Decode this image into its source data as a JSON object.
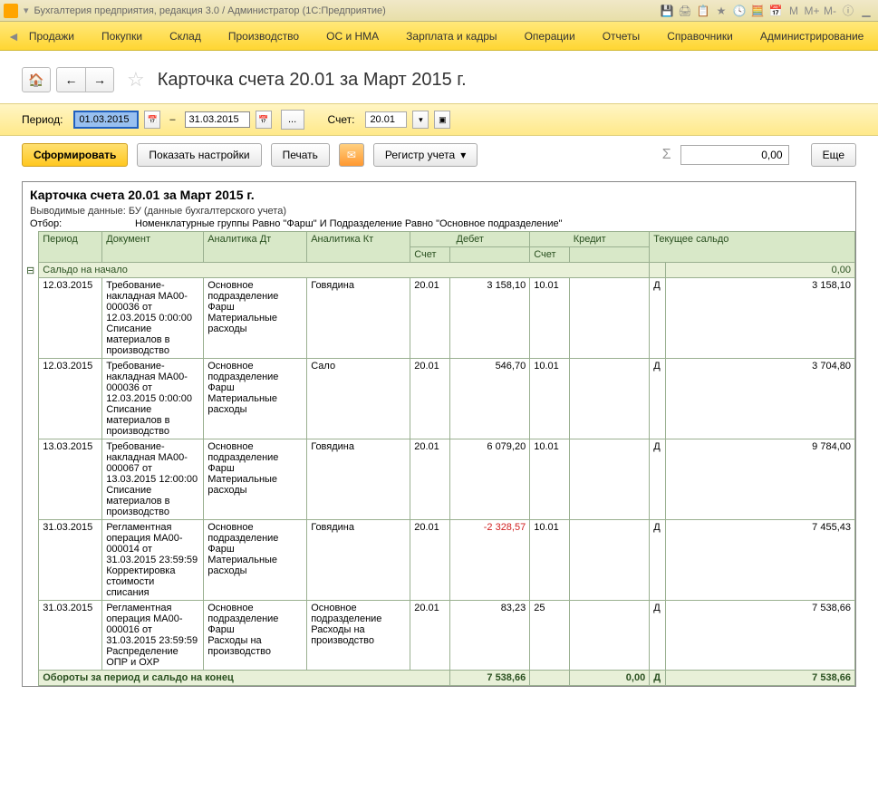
{
  "titlebar": {
    "title": "Бухгалтерия предприятия, редакция 3.0 / Администратор  (1С:Предприятие)"
  },
  "menu": [
    "Продажи",
    "Покупки",
    "Склад",
    "Производство",
    "ОС и НМА",
    "Зарплата и кадры",
    "Операции",
    "Отчеты",
    "Справочники",
    "Администрирование"
  ],
  "page": {
    "title": "Карточка счета 20.01 за Март 2015 г."
  },
  "period": {
    "label": "Период:",
    "from": "01.03.2015",
    "to": "31.03.2015",
    "acct_label": "Счет:",
    "acct": "20.01"
  },
  "actions": {
    "generate": "Сформировать",
    "show_settings": "Показать настройки",
    "print": "Печать",
    "register": "Регистр учета",
    "sum": "0,00",
    "more": "Еще"
  },
  "report": {
    "title": "Карточка счета 20.01 за Март 2015 г.",
    "data_label": "Выводимые данные:",
    "data_value": "БУ (данные бухгалтерского учета)",
    "filter_label": "Отбор:",
    "filter_value": "Номенклатурные группы Равно \"Фарш\" И Подразделение Равно \"Основное подразделение\"",
    "cols": {
      "period": "Период",
      "doc": "Документ",
      "adt": "Аналитика Дт",
      "akt": "Аналитика Кт",
      "debit": "Дебет",
      "credit": "Кредит",
      "acct": "Счет",
      "balance": "Текущее сальдо"
    },
    "saldo_start": "Сальдо на начало",
    "saldo_start_val": "0,00",
    "rows": [
      {
        "period": "12.03.2015",
        "doc": "Требование-накладная МА00-000036 от 12.03.2015 0:00:00\nСписание материалов в производство",
        "adt": "Основное подразделение\nФарш\nМатериальные расходы",
        "akt": "Говядина",
        "d_acct": "20.01",
        "d_amt": "3 158,10",
        "c_acct": "10.01",
        "c_amt": "",
        "side": "Д",
        "bal": "3 158,10"
      },
      {
        "period": "12.03.2015",
        "doc": "Требование-накладная МА00-000036 от 12.03.2015 0:00:00\nСписание материалов в производство",
        "adt": "Основное подразделение\nФарш\nМатериальные расходы",
        "akt": "Сало",
        "d_acct": "20.01",
        "d_amt": "546,70",
        "c_acct": "10.01",
        "c_amt": "",
        "side": "Д",
        "bal": "3 704,80"
      },
      {
        "period": "13.03.2015",
        "doc": "Требование-накладная МА00-000067 от 13.03.2015 12:00:00\nСписание материалов в производство",
        "adt": "Основное подразделение\nФарш\nМатериальные расходы",
        "akt": "Говядина",
        "d_acct": "20.01",
        "d_amt": "6 079,20",
        "c_acct": "10.01",
        "c_amt": "",
        "side": "Д",
        "bal": "9 784,00"
      },
      {
        "period": "31.03.2015",
        "doc": "Регламентная операция МА00-000014 от 31.03.2015 23:59:59\nКорректировка стоимости списания",
        "adt": "Основное подразделение\nФарш\nМатериальные расходы",
        "akt": "Говядина",
        "d_acct": "20.01",
        "d_amt": "-2 328,57",
        "neg": true,
        "c_acct": "10.01",
        "c_amt": "",
        "side": "Д",
        "bal": "7 455,43"
      },
      {
        "period": "31.03.2015",
        "doc": "Регламентная операция МА00-000016 от 31.03.2015 23:59:59\nРаспределение ОПР и ОХР",
        "adt": "Основное подразделение\nФарш\nРасходы на производство",
        "akt": "Основное подразделение\nРасходы на производство",
        "d_acct": "20.01",
        "d_amt": "83,23",
        "c_acct": "25",
        "c_amt": "",
        "side": "Д",
        "bal": "7 538,66"
      }
    ],
    "totals_label": "Обороты за период и сальдо на конец",
    "totals": {
      "debit": "7 538,66",
      "credit": "0,00",
      "side": "Д",
      "bal": "7 538,66"
    }
  }
}
